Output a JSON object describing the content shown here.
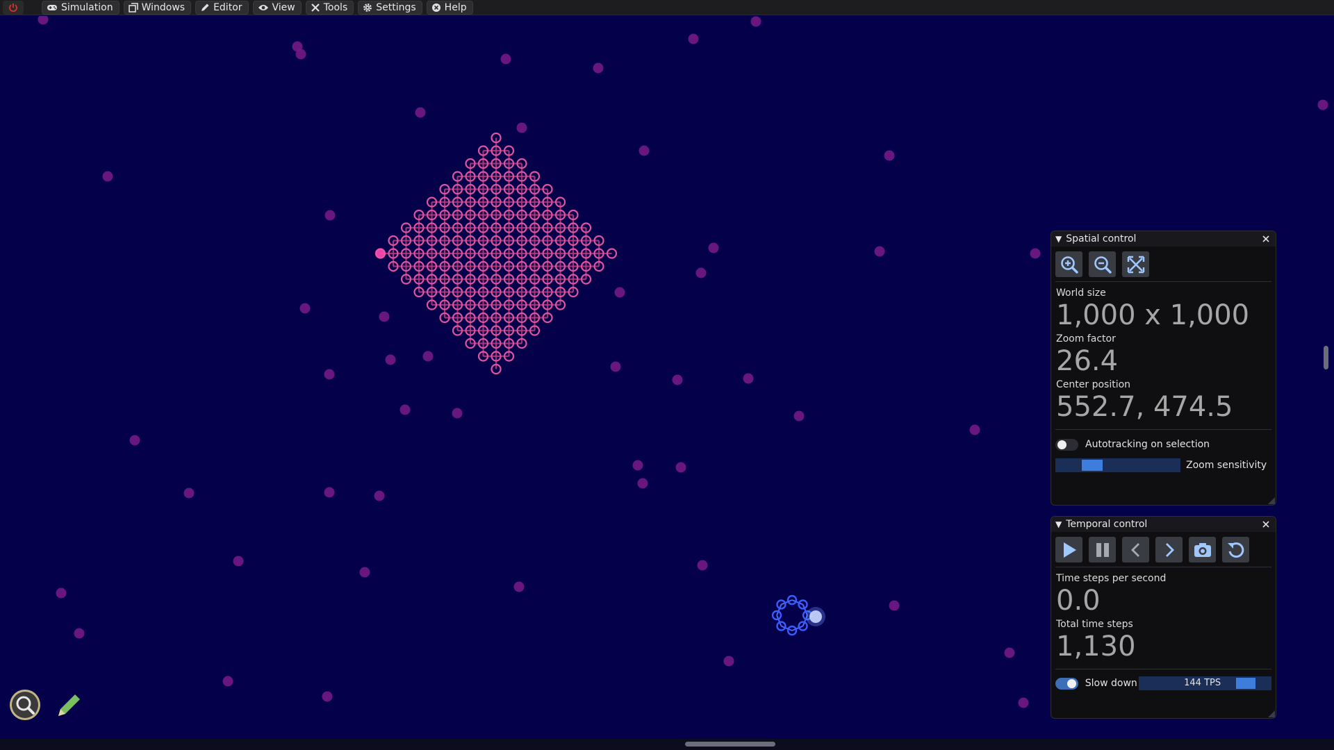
{
  "menu": {
    "items": [
      {
        "label": "Simulation",
        "icon": "gamepad-icon"
      },
      {
        "label": "Windows",
        "icon": "windows-icon"
      },
      {
        "label": "Editor",
        "icon": "pencil-icon"
      },
      {
        "label": "View",
        "icon": "eye-icon"
      },
      {
        "label": "Tools",
        "icon": "tools-icon"
      },
      {
        "label": "Settings",
        "icon": "gear-icon"
      },
      {
        "label": "Help",
        "icon": "help-icon"
      }
    ],
    "power_icon": "power-icon"
  },
  "colors": {
    "world_background": "#05004a",
    "free_particle": "#7a1a8a",
    "lattice_particle": "#e0559f",
    "ring_particle": "#3a5cff",
    "accent": "#3f7ddc"
  },
  "spatial": {
    "title": "Spatial control",
    "buttons": [
      "zoom-in-icon",
      "zoom-out-icon",
      "fit-view-icon"
    ],
    "world_size_label": "World size",
    "world_size_value": "1,000 x 1,000",
    "zoom_factor_label": "Zoom factor",
    "zoom_factor_value": "26.4",
    "center_label": "Center position",
    "center_value": "552.7, 474.5",
    "autotrack_label": "Autotracking on selection",
    "autotrack_on": false,
    "zoom_sensitivity_label": "Zoom sensitivity",
    "zoom_sensitivity_level": 0.25
  },
  "temporal": {
    "title": "Temporal control",
    "buttons": [
      "play-icon",
      "pause-icon",
      "step-back-icon",
      "step-forward-icon",
      "snapshot-icon",
      "restore-icon"
    ],
    "tps_label": "Time steps per second",
    "tps_value": "0.0",
    "total_label": "Total time steps",
    "total_value": "1,130",
    "slowdown_label": "Slow down",
    "slowdown_on": true,
    "slowdown_tps": "144 TPS",
    "slowdown_level": 0.85
  },
  "overlay_tools": [
    "zoom-mode-icon",
    "edit-mode-icon"
  ]
}
